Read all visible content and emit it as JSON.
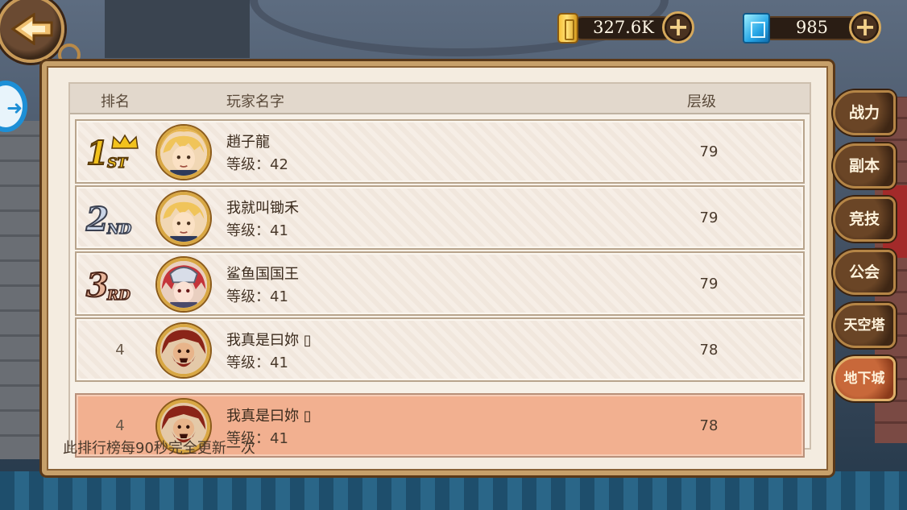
{
  "currency": {
    "gold_amount": "327.6K",
    "gem_amount": "985",
    "add_glyph": "+"
  },
  "side_left_glyph": "➜",
  "table": {
    "headers": {
      "rank": "排名",
      "player": "玩家名字",
      "floor": "层级"
    },
    "rows": [
      {
        "rank": "1ST",
        "rank_number": 1,
        "name": "趙子龍",
        "level": "等级：42",
        "floor": "79",
        "avatar": "blonde-hero"
      },
      {
        "rank": "2ND",
        "rank_number": 2,
        "name": "我就叫锄禾",
        "level": "等级：41",
        "floor": "79",
        "avatar": "blonde-hero"
      },
      {
        "rank": "3RD",
        "rank_number": 3,
        "name": "鲨鱼国国王",
        "level": "等级：41",
        "floor": "79",
        "avatar": "masked-redhead"
      },
      {
        "rank": "4",
        "rank_number": 4,
        "name": "我真是曰妳 ▯",
        "level": "等级：41",
        "floor": "78",
        "avatar": "bearded-warrior"
      }
    ],
    "self_row": {
      "rank": "4",
      "name": "我真是曰妳 ▯",
      "level": "等级：41",
      "floor": "78",
      "avatar": "bearded-warrior"
    }
  },
  "footer_note": "此排行榜每90秒完全更新一次",
  "side_tabs": [
    {
      "label": "战力",
      "active": false
    },
    {
      "label": "副本",
      "active": false
    },
    {
      "label": "竞技",
      "active": false
    },
    {
      "label": "公会",
      "active": false
    },
    {
      "label": "天空塔",
      "active": false
    },
    {
      "label": "地下城",
      "active": true
    }
  ],
  "colors": {
    "gold_badge": "#f2c21c",
    "silver_badge": "#c9d4e6",
    "bronze_badge": "#e8b59a",
    "highlight_row": "#f2b090"
  }
}
